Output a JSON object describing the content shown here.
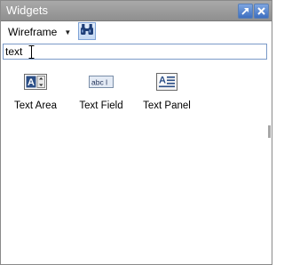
{
  "window": {
    "title": "Widgets"
  },
  "toolbar": {
    "library_label": "Wireframe",
    "caret": "▼"
  },
  "search": {
    "value": "text"
  },
  "widgets": [
    {
      "label": "Text Area",
      "icon": "text-area-icon"
    },
    {
      "label": "Text Field",
      "icon": "text-field-icon",
      "icon_text": "abc l"
    },
    {
      "label": "Text Panel",
      "icon": "text-panel-icon"
    }
  ],
  "colors": {
    "titlebar": "#999999",
    "title_text": "#ffffff",
    "title_button": "#4a7fd0",
    "find_button": "#cfe0f6"
  }
}
